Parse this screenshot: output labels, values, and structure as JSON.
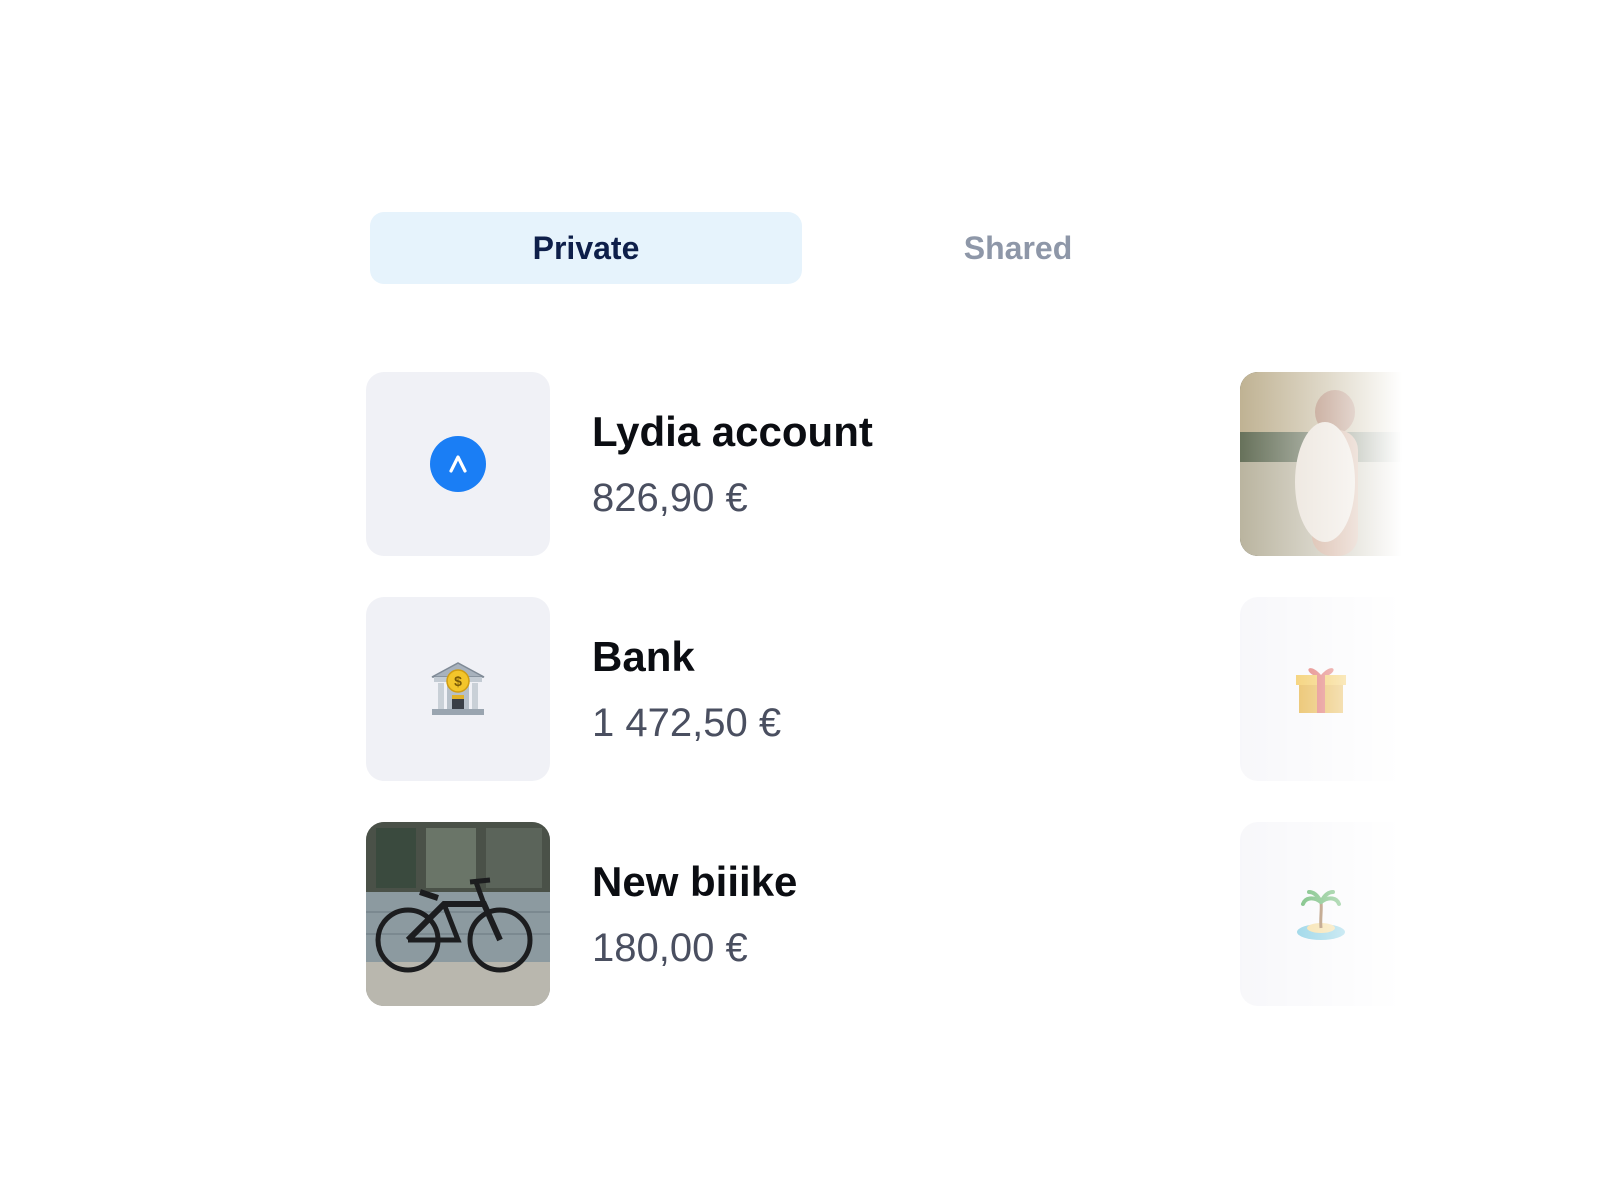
{
  "tabs": {
    "private_label": "Private",
    "shared_label": "Shared",
    "active": "private"
  },
  "accounts": [
    {
      "title": "Lydia account",
      "amount": "826,90 €",
      "icon": "lydia-logo-icon"
    },
    {
      "title": "Bank",
      "amount": "1 472,50 €",
      "icon": "bank-icon"
    },
    {
      "title": "New biiike",
      "amount": "180,00 €",
      "icon": "bicycle-photo"
    }
  ],
  "shared_previews": [
    {
      "icon": "couple-photo"
    },
    {
      "icon": "gift-icon"
    },
    {
      "icon": "desert-island-icon"
    }
  ],
  "colors": {
    "active_tab_bg": "#e6f3fc",
    "active_tab_text": "#0e1f4a",
    "inactive_tab_text": "#8e97a8",
    "lydia_blue": "#1a7ef5",
    "thumb_bg": "#f0f1f6"
  }
}
